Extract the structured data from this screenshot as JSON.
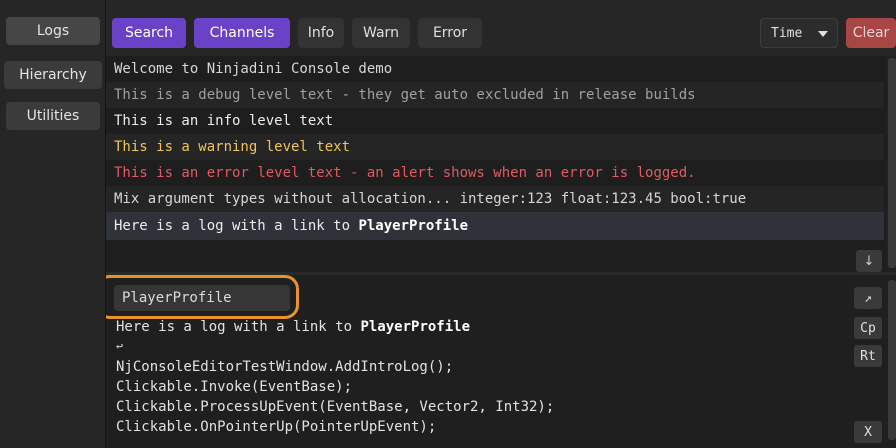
{
  "sidebar": {
    "items": [
      {
        "label": "Logs"
      },
      {
        "label": "Hierarchy"
      },
      {
        "label": "Utilities"
      }
    ]
  },
  "toolbar": {
    "search_label": "Search",
    "channels_label": "Channels",
    "info_label": "Info",
    "warn_label": "Warn",
    "error_label": "Error",
    "time_dropdown_value": "Time",
    "clear_label": "Clear"
  },
  "logs": {
    "rows": [
      {
        "text": "Welcome to Ninjadini Console demo"
      },
      {
        "text": "This is a debug level text - they get auto excluded in release builds"
      },
      {
        "text": "This is an info level text"
      },
      {
        "text": "This is a warning level text"
      },
      {
        "text": "This is an error level text - an alert shows when an error is logged."
      },
      {
        "text": "Mix argument types without allocation... integer:123 float:123.45 bool:true"
      },
      {
        "text_prefix": "Here is a log with a link to ",
        "link": "PlayerProfile"
      }
    ],
    "scroll_down_glyph": "↓"
  },
  "detail": {
    "link_chip_label": "PlayerProfile",
    "message_prefix": "Here is a log with a link to ",
    "message_link": "PlayerProfile",
    "return_glyph": "↩",
    "stack_lines": [
      "NjConsoleEditorTestWindow.AddIntroLog();",
      "Clickable.Invoke(EventBase);",
      "Clickable.ProcessUpEvent(EventBase, Vector2, Int32);",
      "Clickable.OnPointerUp(PointerUpEvent);"
    ],
    "open_glyph": "↗",
    "copy_label": "Cp",
    "rt_label": "Rt",
    "close_label": "X"
  }
}
